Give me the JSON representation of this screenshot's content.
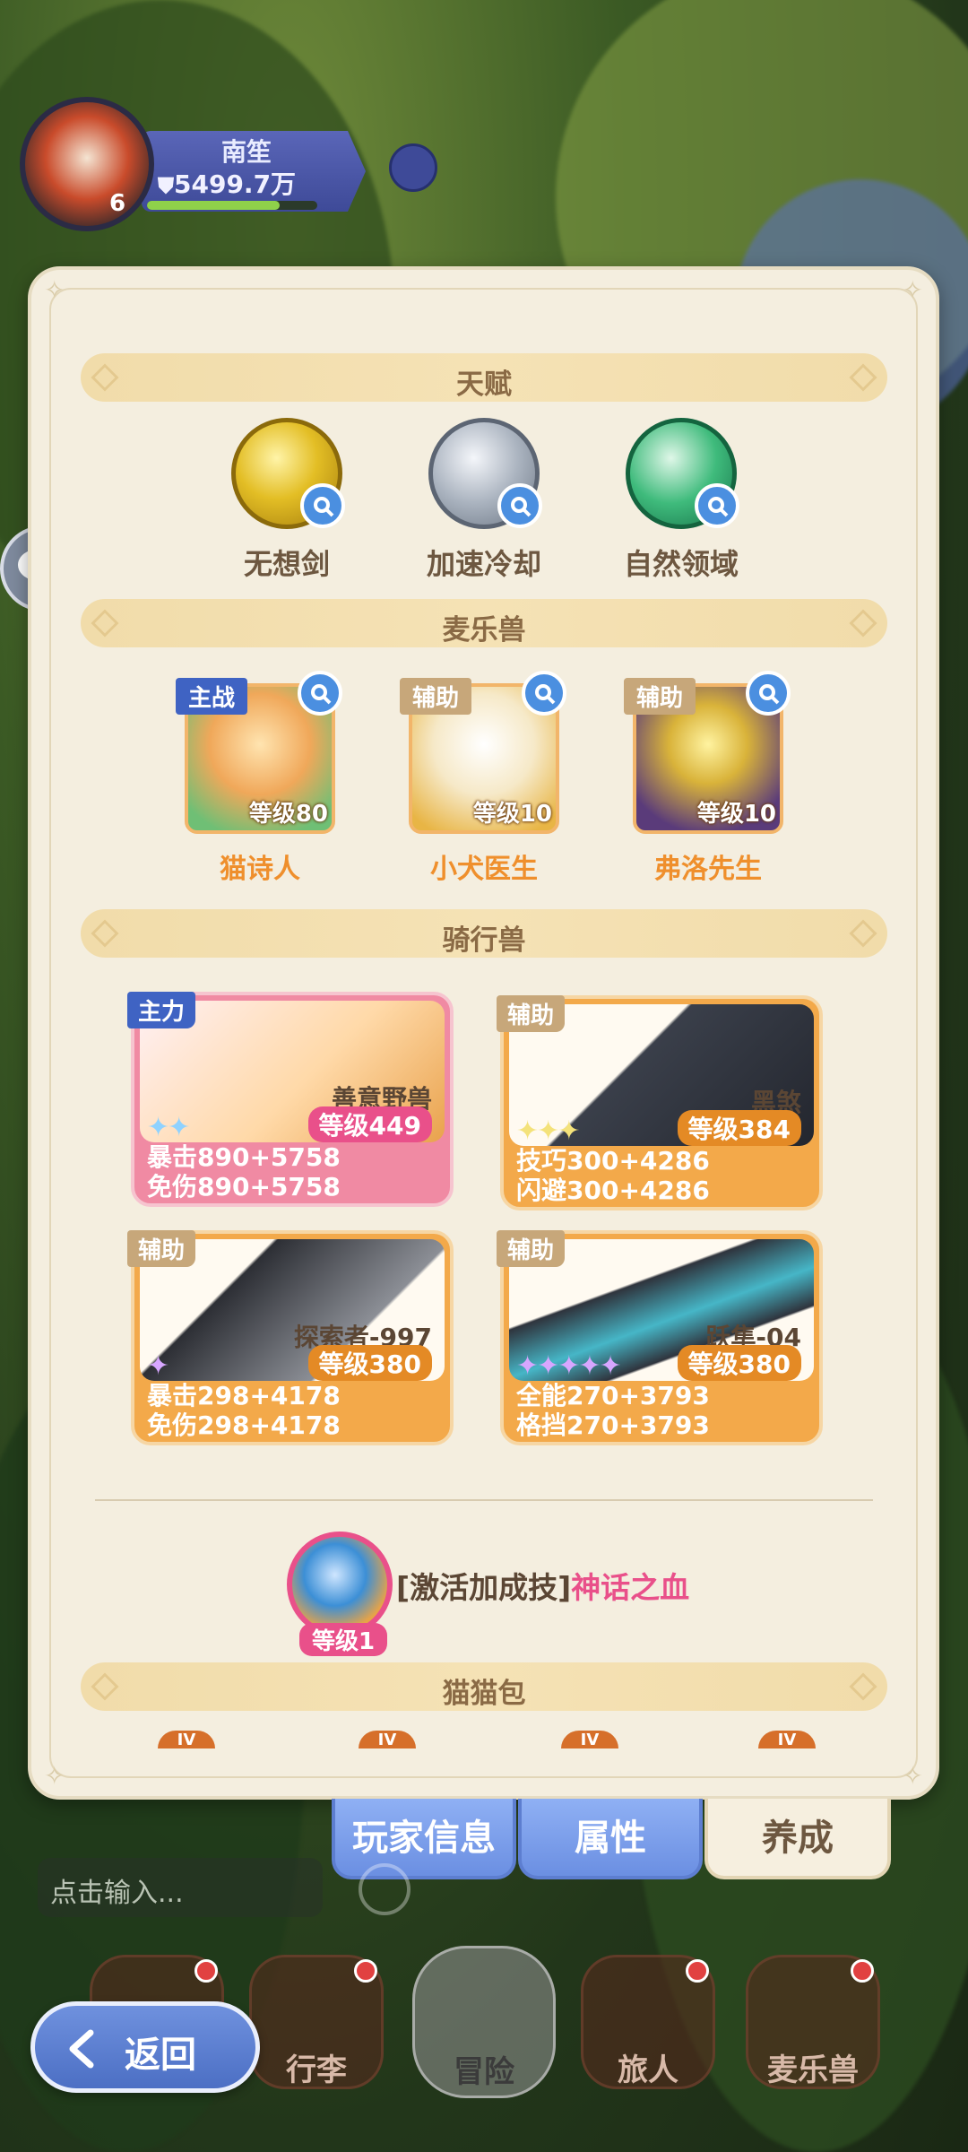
{
  "player": {
    "name": "南笙",
    "power": "5499.7万",
    "level": "6"
  },
  "sections": {
    "talent": "天赋",
    "pets": "麦乐兽",
    "mounts": "骑行兽",
    "bag": "猫猫包"
  },
  "talents": [
    {
      "name": "无想剑",
      "icon": "sword-talent-icon",
      "color": "#d9b21c"
    },
    {
      "name": "加速冷却",
      "icon": "cooldown-talent-icon",
      "color": "#8c96a4"
    },
    {
      "name": "自然领域",
      "icon": "nature-talent-icon",
      "color": "#2fa46b"
    }
  ],
  "pets": [
    {
      "tag": "主战",
      "level": "等级80",
      "name": "猫诗人"
    },
    {
      "tag": "辅助",
      "level": "等级10",
      "name": "小犬医生"
    },
    {
      "tag": "辅助",
      "level": "等级10",
      "name": "弗洛先生"
    }
  ],
  "mounts": [
    {
      "tag": "主力",
      "name": "善意野兽",
      "level": "等级449",
      "stars": "✦✦",
      "stat1": "暴击890+5758",
      "stat2": "免伤890+5758"
    },
    {
      "tag": "辅助",
      "name": "黑煞",
      "level": "等级384",
      "stars": "✦✦✦",
      "stat1": "技巧300+4286",
      "stat2": "闪避300+4286"
    },
    {
      "tag": "辅助",
      "name": "探索者-997",
      "level": "等级380",
      "stars": "✦",
      "stat1": "暴击298+4178",
      "stat2": "免伤298+4178"
    },
    {
      "tag": "辅助",
      "name": "跃隼-04",
      "level": "等级380",
      "stars": "✦✦✦✦✦",
      "stat1": "全能270+3793",
      "stat2": "格挡270+3793"
    }
  ],
  "combo": {
    "prefix": "[激活加成技]",
    "name": "神话之血",
    "level": "等级1"
  },
  "bag_tabs": [
    "IV",
    "IV",
    "IV",
    "IV"
  ],
  "tabs": {
    "player_info": "玩家信息",
    "attributes": "属性",
    "cultivate": "养成"
  },
  "chat_input": {
    "placeholder": "点击输入..."
  },
  "nav": {
    "item1": "行李",
    "item2": "冒险",
    "item3": "旅人",
    "item4": "麦乐兽"
  },
  "back": "返回",
  "colors": {
    "accent_blue": "#6b8fe2",
    "pink": "#e9508a",
    "orange": "#ef8f2c",
    "cream": "#f4eedf"
  }
}
